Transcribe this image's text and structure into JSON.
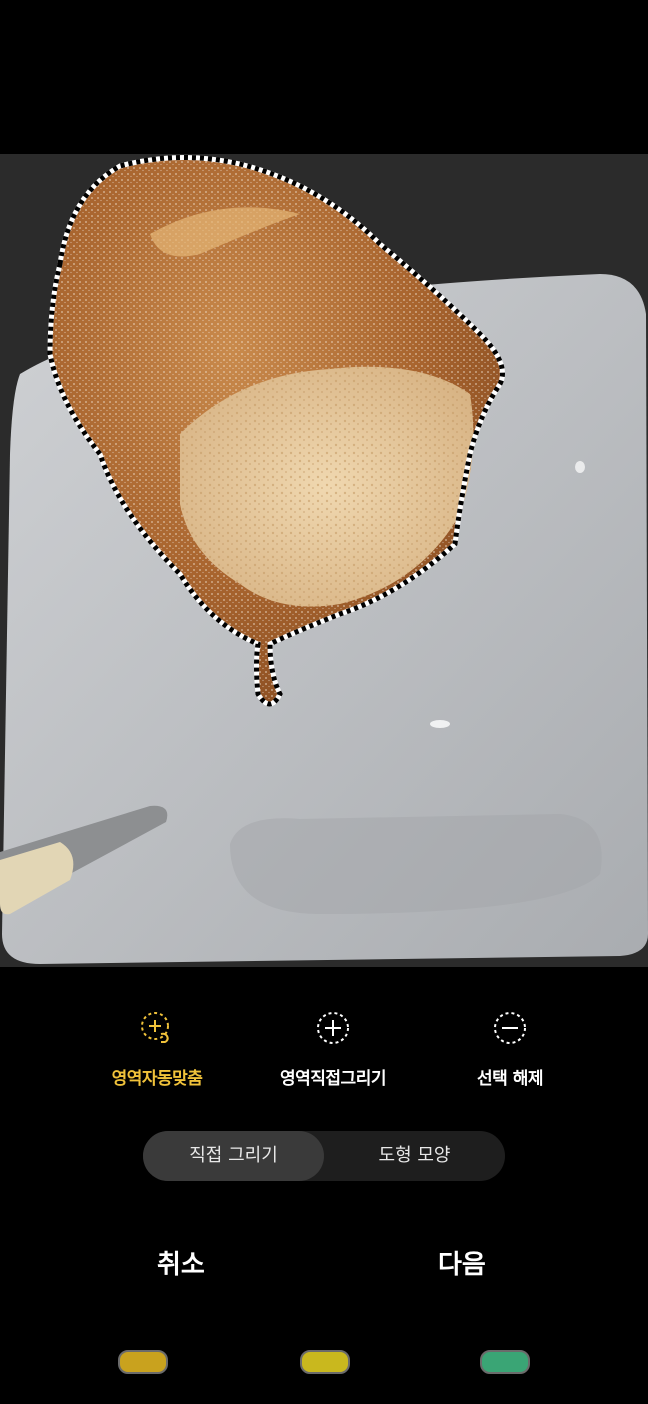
{
  "photo": {
    "subject": "bread-on-plate"
  },
  "tools": [
    {
      "label": "영역자동맞춤",
      "icon": "auto-fit-selection-icon",
      "active": true
    },
    {
      "label": "영역직접그리기",
      "icon": "add-selection-icon",
      "active": false
    },
    {
      "label": "선택 해제",
      "icon": "remove-selection-icon",
      "active": false
    }
  ],
  "mode_toggle": {
    "options": [
      "직접 그리기",
      "도형 모양"
    ],
    "selected": 0
  },
  "actions": {
    "cancel": "취소",
    "next": "다음"
  },
  "colors": {
    "accent": "#f0c23a",
    "background": "#000000"
  },
  "nav_buttons": [
    {
      "icon": "recent-apps-icon",
      "color": "#c9a21e"
    },
    {
      "icon": "home-icon",
      "color": "#c9b81e"
    },
    {
      "icon": "back-icon",
      "color": "#3aa575"
    }
  ]
}
